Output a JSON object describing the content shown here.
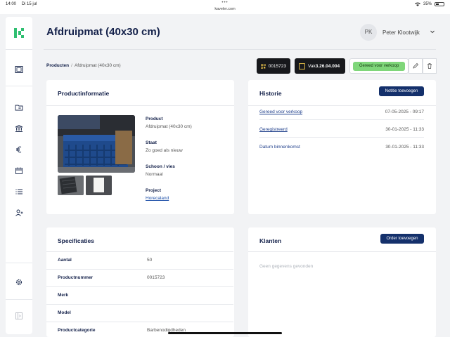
{
  "status_bar": {
    "time": "14:00",
    "date": "Di 15 jul",
    "dots": "•••",
    "url": "kaveler.com",
    "battery": "35%"
  },
  "header": {
    "title": "Afdruipmat (40x30 cm)",
    "user_initials": "PK",
    "user_name": "Peter Klootwijk"
  },
  "breadcrumb": {
    "root": "Producten",
    "separator": "/",
    "current": "Afdruipmat (40x30 cm)"
  },
  "actions": {
    "code": "0015723",
    "vak_prefix": "Vak",
    "vak_value": "3.26.04.004",
    "status": "Gereed voor verkoop",
    "status_color": "#7fd67a"
  },
  "product_info": {
    "title": "Productinformatie",
    "fields": [
      {
        "label": "Product",
        "value": "Afdruipmat (40x30 cm)"
      },
      {
        "label": "Staat",
        "value": "Zo goed als nieuw"
      },
      {
        "label": "Schoon / vies",
        "value": "Normaal"
      },
      {
        "label": "Project",
        "value": "Horecaland"
      }
    ]
  },
  "history": {
    "title": "Historie",
    "add_button": "Notitie toevoegen",
    "entries": [
      {
        "label": "Gereed voor verkoop",
        "date": "07-05-2025 - 09:17"
      },
      {
        "label": "Geregistreerd",
        "date": "30-01-2025 - 11:33"
      },
      {
        "label": "Datum binnenkomst",
        "date": "30-01-2025 - 11:33"
      }
    ]
  },
  "specs": {
    "title": "Specificaties",
    "rows": [
      {
        "label": "Aantal",
        "value": "50"
      },
      {
        "label": "Productnummer",
        "value": "0015723"
      },
      {
        "label": "Merk",
        "value": ""
      },
      {
        "label": "Model",
        "value": ""
      },
      {
        "label": "Productcategorie",
        "value": "Barbenodigdheden"
      }
    ]
  },
  "customers": {
    "title": "Klanten",
    "add_button": "Order toevoegen",
    "empty": "Geen gegevens gevonden"
  },
  "colors": {
    "brand_green": "#2fbf71",
    "navy": "#14306b",
    "background": "#f2f3f5"
  },
  "icons": {
    "sidebar": [
      "dashboard-icon",
      "folder-icon",
      "bank-icon",
      "euro-icon",
      "calendar-icon",
      "list-icon",
      "user-group-icon",
      "settings-icon",
      "collapse-icon"
    ],
    "actions": [
      "qr-icon",
      "box-icon",
      "edit-icon",
      "trash-icon"
    ]
  }
}
